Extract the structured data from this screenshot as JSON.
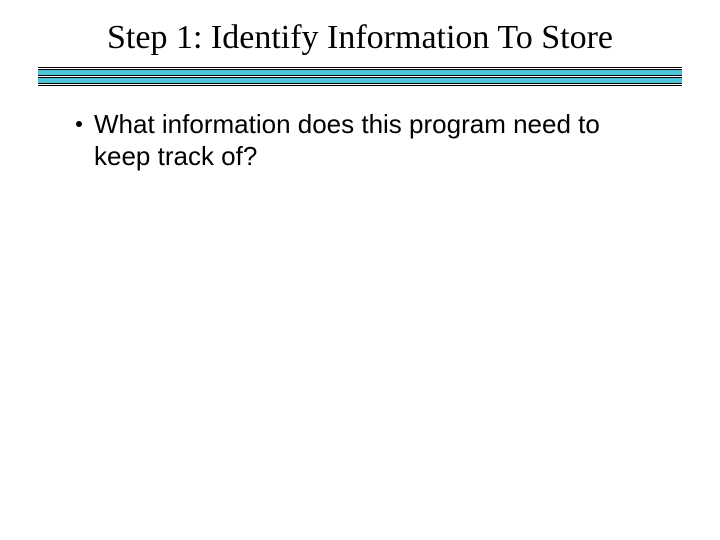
{
  "title": "Step 1: Identify Information To Store",
  "bullets": [
    "What information does this program need to keep track of?"
  ]
}
